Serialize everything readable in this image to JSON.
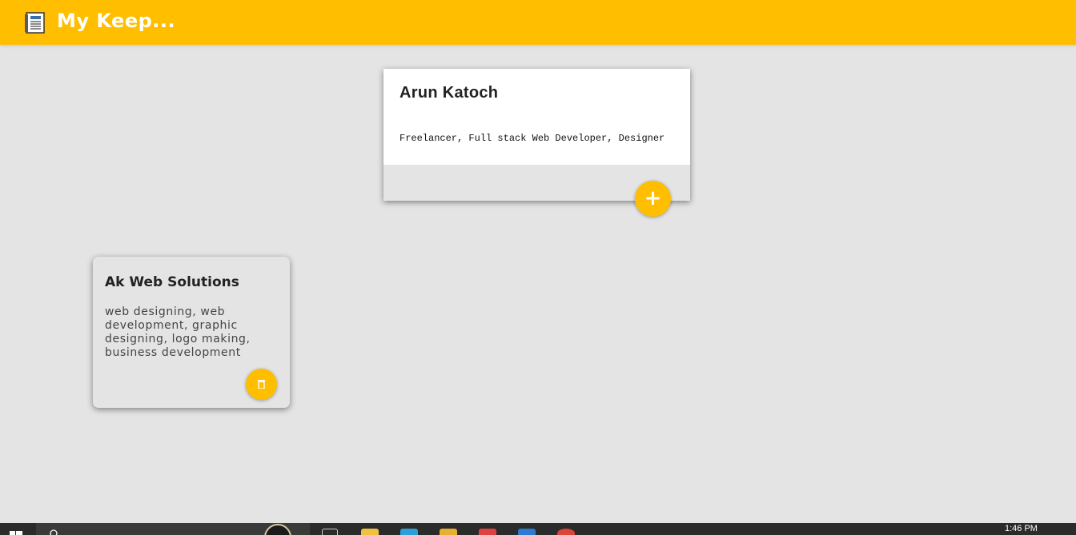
{
  "header": {
    "title": "My Keep...",
    "logo_icon": "notebook-icon"
  },
  "create_note": {
    "title": "Arun Katoch",
    "content": "Freelancer, Full stack Web Developer, Designer",
    "add_icon": "plus-icon",
    "add_label": "+"
  },
  "notes": [
    {
      "title": "Ak Web Solutions",
      "content": "web designing, web development, graphic designing, logo making, business development",
      "delete_icon": "trash-icon"
    }
  ],
  "colors": {
    "brand": "#ffbe00",
    "background": "#e4e4e4",
    "card": "#ffffff",
    "taskbar": "#2b2b2b"
  },
  "taskbar": {
    "time": "1:46 PM",
    "icons": [
      "windows-start-icon",
      "search-icon",
      "cortana-icon",
      "task-view-icon",
      "file-explorer-icon",
      "store-icon",
      "paint-icon",
      "app-icon",
      "vscode-icon",
      "chrome-icon"
    ]
  }
}
